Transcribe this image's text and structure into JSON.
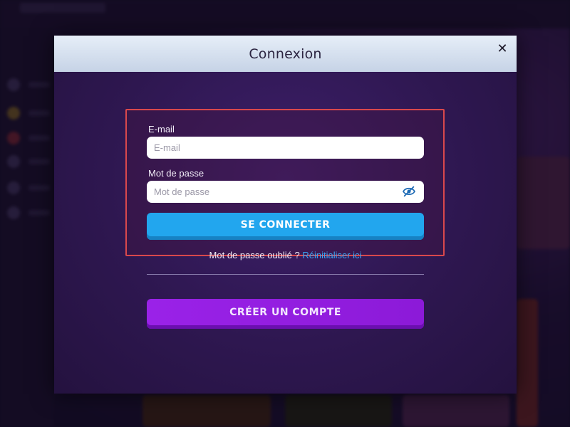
{
  "modal": {
    "title": "Connexion",
    "close_symbol": "✕"
  },
  "form": {
    "email": {
      "label": "E-mail",
      "placeholder": "E-mail",
      "value": ""
    },
    "password": {
      "label": "Mot de passe",
      "placeholder": "Mot de passe",
      "value": "",
      "toggle_icon": "eye-slash-icon"
    },
    "login_button": "SE CONNECTER",
    "forgot_text": "Mot de passe oublié ?",
    "reset_link": "Réinitialiser ici",
    "create_account_button": "CRÉER UN COMPTE"
  },
  "colors": {
    "login_button": "#22a6ee",
    "create_account_button": "#9a22e8",
    "highlight_border": "#d9484c",
    "link": "#3aa4f2"
  }
}
